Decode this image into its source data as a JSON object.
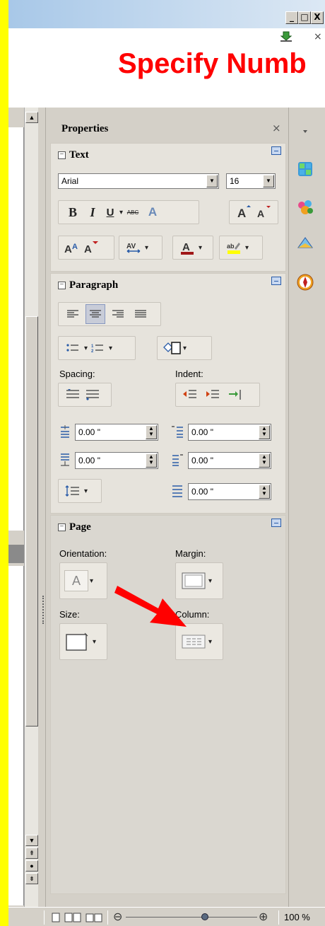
{
  "window": {
    "min_label": "_",
    "max_label": "□",
    "close_label": "X",
    "doc_close": "×"
  },
  "document": {
    "heading": "Specify Numb"
  },
  "sidebar": {
    "title": "Properties",
    "close": "×",
    "text_panel": {
      "title": "Text",
      "font_name": "Arial",
      "font_size": "16",
      "bold": "B",
      "italic": "I",
      "underline": "U",
      "strike": "ABC",
      "shadow": "A"
    },
    "paragraph_panel": {
      "title": "Paragraph",
      "spacing_label": "Spacing:",
      "indent_label": "Indent:",
      "above_spacing": "0.00 \"",
      "below_spacing": "0.00 \"",
      "before_indent": "0.00 \"",
      "after_indent": "0.00 \"",
      "first_line_indent": "0.00 \""
    },
    "page_panel": {
      "title": "Page",
      "orientation_label": "Orientation:",
      "margin_label": "Margin:",
      "size_label": "Size:",
      "column_label": "Column:",
      "orientation_glyph": "A"
    }
  },
  "statusbar": {
    "zoom_minus": "⊖",
    "zoom_plus": "⊕",
    "zoom_level": "100 %",
    "zoom_fraction": 0.6
  },
  "colors": {
    "heading": "#ff0000",
    "highlight_marker": "#ff0000",
    "accent_blue": "#2a5ca8"
  }
}
